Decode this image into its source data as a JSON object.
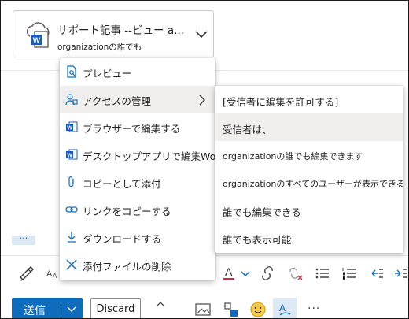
{
  "attachment": {
    "file_name": "サポート記事 --ビュー a...",
    "sharing": "organizationの誰でも",
    "icon": "word-cloud-file-icon"
  },
  "compose": {
    "more_label": "···"
  },
  "context_menu": {
    "items": [
      {
        "label": "プレビュー",
        "icon": "preview-icon"
      },
      {
        "label": "アクセスの管理",
        "icon": "manage-access-icon"
      },
      {
        "label": "ブラウザーで編集する",
        "icon": "word-icon"
      },
      {
        "label": "デスクトップアプリで編集Word",
        "icon": "word-icon"
      },
      {
        "label": "コピーとして添付",
        "icon": "paperclip-icon"
      },
      {
        "label": "リンクをコピーする",
        "icon": "link-icon"
      },
      {
        "label": "ダウンロードする",
        "icon": "download-icon"
      },
      {
        "label": "添付ファイルの削除",
        "icon": "close-icon"
      }
    ]
  },
  "submenu": {
    "items": [
      {
        "label": "[受信者に編集を許可する]"
      },
      {
        "label": "受信者は、"
      },
      {
        "label": "organizationの誰でも編集できます"
      },
      {
        "label": "organizationのすべてのユーザーが表示できる"
      },
      {
        "label": "誰でも編集できる"
      },
      {
        "label": "誰でも表示可能"
      }
    ]
  },
  "bottom_bar": {
    "send_label": "送信",
    "discard_label": "Discard"
  },
  "colors": {
    "accent": "#0f6cbd",
    "word_blue": "#185abd",
    "font_color_red": "#c4314b",
    "highlight": "#dce9f5"
  }
}
